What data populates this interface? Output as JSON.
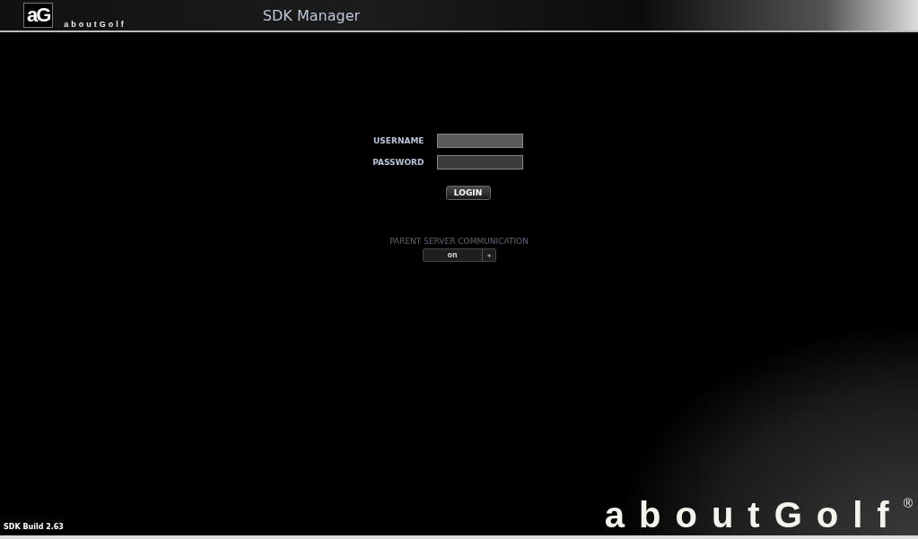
{
  "header": {
    "logo_mark": "aG",
    "logo_text": "aboutGolf",
    "title": "SDK Manager"
  },
  "login": {
    "fields": [
      {
        "label": "USERNAME",
        "focused": true
      },
      {
        "label": "PASSWORD",
        "focused": false
      }
    ],
    "button": "LOGIN"
  },
  "parent_server": {
    "label": "PARENT SERVER COMMUNICATION",
    "value": "on",
    "arrow": "◂"
  },
  "footer": {
    "build": "SDK Build 2.63",
    "brand": "aboutGolf$^{®}$"
  }
}
